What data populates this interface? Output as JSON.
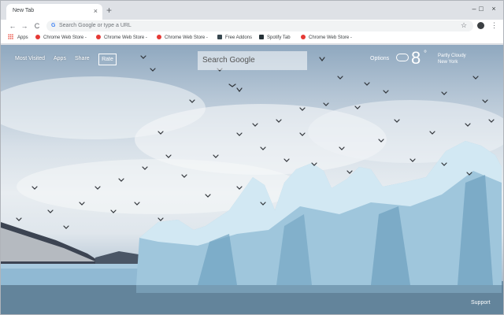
{
  "tab": {
    "title": "New Tab",
    "close": "×",
    "new": "+"
  },
  "window_controls": {
    "minimize": "–",
    "maximize": "□",
    "close": "×"
  },
  "toolbar": {
    "back": "←",
    "forward": "→",
    "reload": "C",
    "omnibox_icon": "G",
    "omnibox_placeholder": "Search Google or type a URL",
    "star": "☆",
    "menu": "⋮"
  },
  "bookmarks": [
    {
      "label": "Apps",
      "icon": "apps-grid-icon"
    },
    {
      "label": "Chrome Web Store -",
      "icon": "chrome-web-store-icon"
    },
    {
      "label": "Chrome Web Store -",
      "icon": "chrome-web-store-icon"
    },
    {
      "label": "Chrome Web Store -",
      "icon": "chrome-web-store-icon"
    },
    {
      "label": "Free Addons",
      "icon": "addon-icon"
    },
    {
      "label": "Spotify Tab",
      "icon": "spotify-icon"
    },
    {
      "label": "Chrome Web Store -",
      "icon": "chrome-web-store-icon"
    }
  ],
  "newtab": {
    "links": [
      "Most Visited",
      "Apps",
      "Share"
    ],
    "rate": "Rate",
    "search_placeholder": "Search Google",
    "options": "Options",
    "weather": {
      "temp": "8",
      "unit": "°",
      "condition": "Partly Cloudy",
      "location": "New York"
    },
    "support": "Support"
  },
  "colors": {
    "accent": "#4285f4",
    "tab_bg": "#ffffff",
    "strip_bg": "#dee1e6"
  }
}
